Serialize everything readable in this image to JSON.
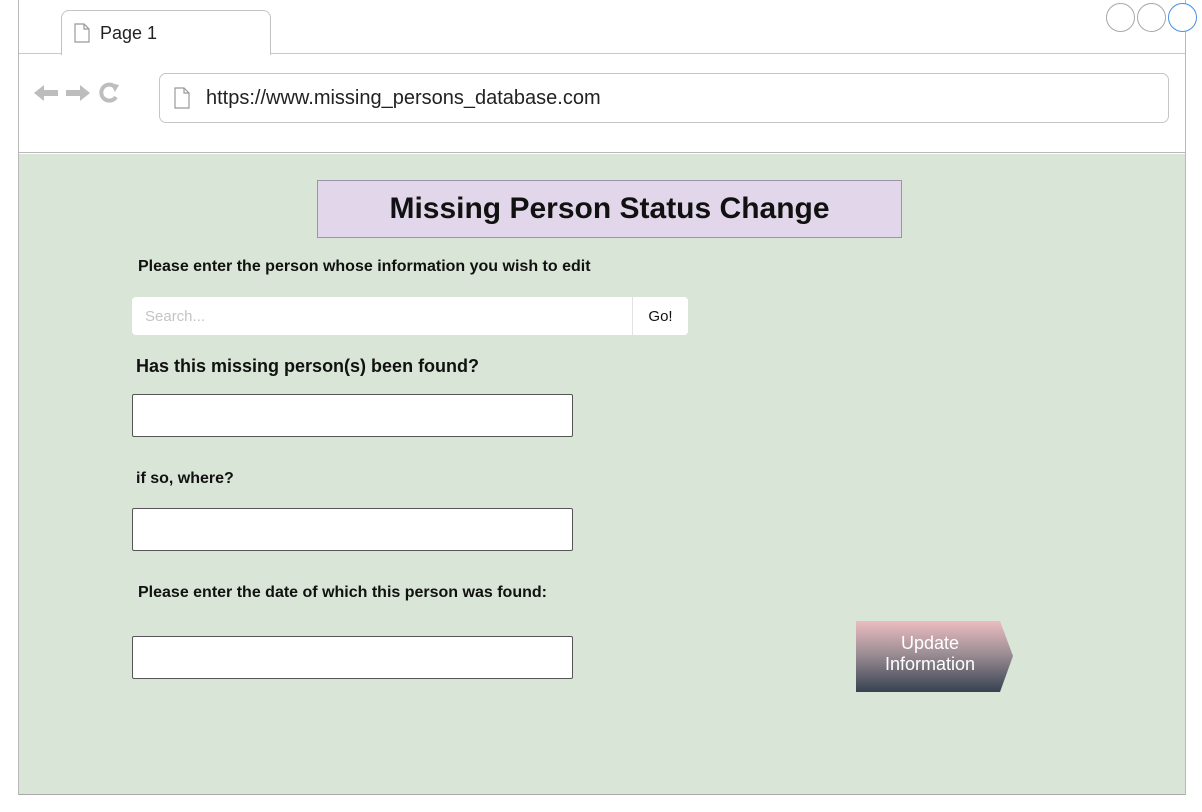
{
  "browser": {
    "tab_label": "Page 1",
    "url": "https://www.missing_persons_database.com"
  },
  "page": {
    "title": "Missing Person Status Change",
    "search": {
      "prompt": "Please enter the person whose information you wish to edit",
      "placeholder": "Search...",
      "go_label": "Go!"
    },
    "found_question": "Has this missing person(s) been found?",
    "where_question": "if so, where?",
    "date_question": "Please enter the date of which this person was found:",
    "update_button_label": "Update\nInformation"
  },
  "colors": {
    "content_background": "#d9e5d6",
    "title_background": "#e2d7ea",
    "window_control_active": "#4a90e2"
  }
}
